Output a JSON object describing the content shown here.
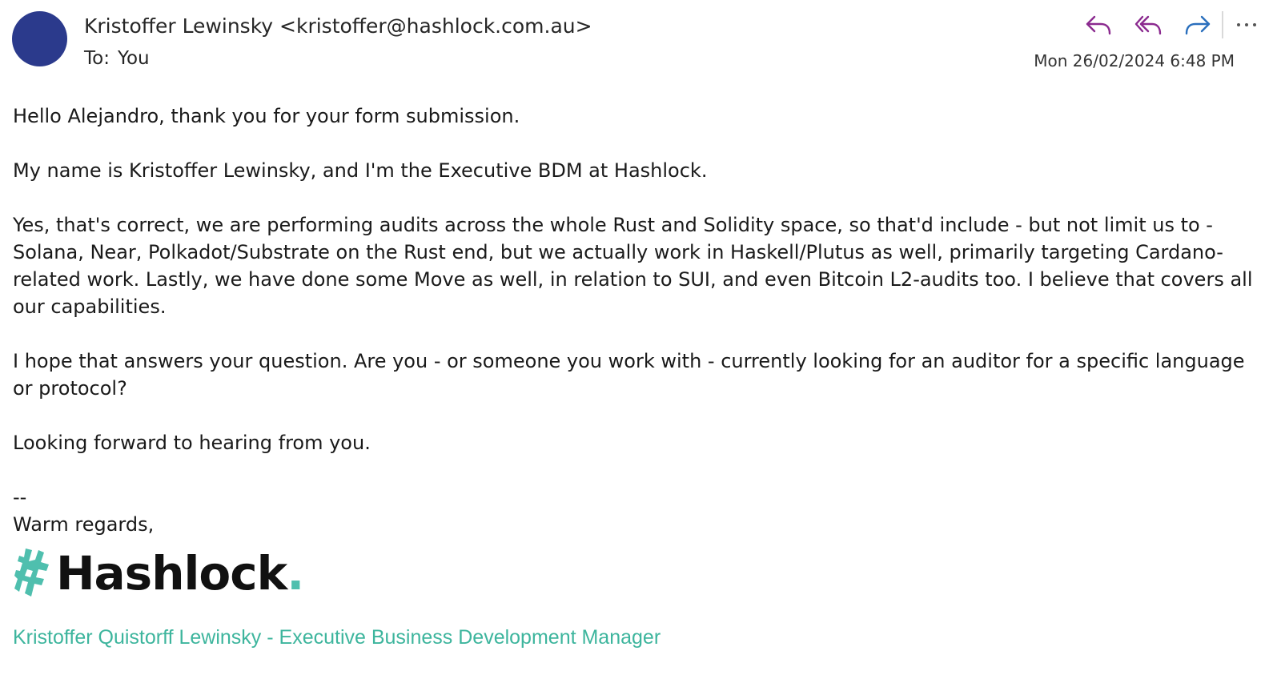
{
  "email": {
    "sender_display": "Kristoffer Lewinsky <kristoffer@hashlock.com.au>",
    "to_label": "To:",
    "to_value": "You",
    "date": "Mon 26/02/2024 6:48 PM",
    "avatar_color": "#2b3a8c"
  },
  "actions": {
    "reply_icon": "reply-icon",
    "reply_all_icon": "reply-all-icon",
    "forward_icon": "forward-icon",
    "more_icon": "more-icon",
    "reply_color": "#8b2a8f",
    "forward_color": "#2a6fbd"
  },
  "body": {
    "paragraphs": [
      "Hello Alejandro, thank you for your form submission.",
      "My name is Kristoffer Lewinsky, and I'm the Executive BDM at Hashlock.",
      "Yes, that's correct, we are performing audits across the whole Rust and Solidity space, so that'd include - but not limit us to - Solana, Near, Polkadot/Substrate on the Rust end, but we actually work in Haskell/Plutus as well, primarily targeting Cardano-related work. Lastly, we have done some Move as well, in relation to SUI, and even Bitcoin L2-audits too. I believe that covers all our capabilities.",
      "I hope that answers your question. Are you - or someone you work with - currently looking for an auditor for a specific language or protocol?",
      "Looking forward to hearing from you."
    ],
    "sig_dash": "--",
    "sig_regards": "Warm regards,"
  },
  "signature": {
    "logo_text": "Hashlock",
    "logo_dot": ".",
    "logo_icon": "hashlock-logo-icon",
    "name_title": "Kristoffer Quistorff Lewinsky - Executive Business Development Manager",
    "accent_color": "#3db59d"
  }
}
